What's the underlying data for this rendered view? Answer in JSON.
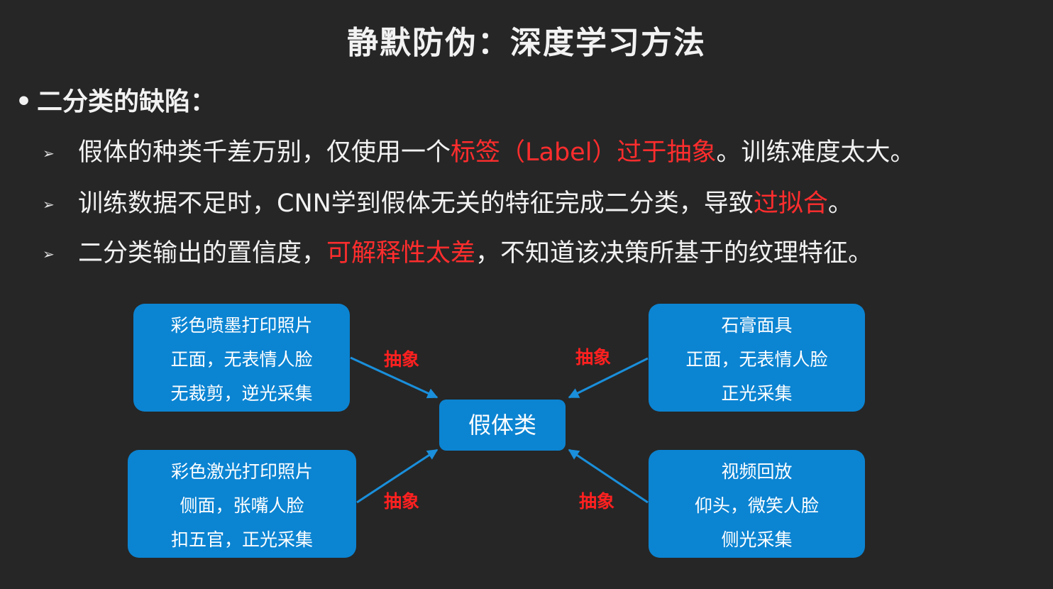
{
  "title": "静默防伪：深度学习方法",
  "section": {
    "bullet": "•",
    "heading": "二分类的缺陷："
  },
  "bullets": [
    {
      "marker": "➢",
      "seg1": "假体的种类千差万别，仅使用一个",
      "seg2": "标签（Label）过于抽象",
      "seg3": "。训练难度太大。"
    },
    {
      "marker": "➢",
      "seg1": "训练数据不足时，CNN学到假体无关的特征完成二分类，导致",
      "seg2": "过拟合",
      "seg3": "。"
    },
    {
      "marker": "➢",
      "seg1": "二分类输出的置信度，",
      "seg2": "可解释性太差",
      "seg3": "，不知道该决策所基于的纹理特征。"
    }
  ],
  "diagram": {
    "center": "假体类",
    "boxes": {
      "top_left": [
        "彩色喷墨打印照片",
        "正面，无表情人脸",
        "无裁剪，逆光采集"
      ],
      "bottom_left": [
        "彩色激光打印照片",
        "侧面，张嘴人脸",
        "扣五官，正光采集"
      ],
      "top_right": [
        "石膏面具",
        "正面，无表情人脸",
        "正光采集"
      ],
      "bottom_right": [
        "视频回放",
        "仰头，微笑人脸",
        "侧光采集"
      ]
    },
    "edge_label": "抽象"
  },
  "colors": {
    "background": "#262626",
    "text": "#f2f2f2",
    "highlight": "#ff2d2d",
    "box_fill": "#0b84d2",
    "arrow": "#1a8fdb",
    "edge_label": "#ff2020"
  }
}
